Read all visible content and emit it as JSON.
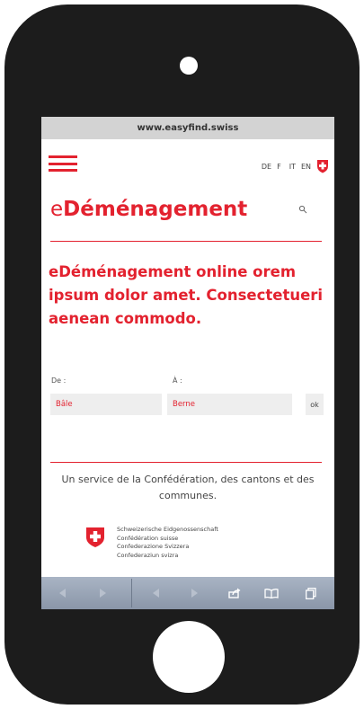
{
  "browser": {
    "url": "www.easyfind.swiss"
  },
  "header": {
    "languages": [
      "DE",
      "F",
      "IT",
      "EN"
    ],
    "menu_icon": "hamburger-icon",
    "flag_icon": "swiss-flag-icon"
  },
  "page": {
    "title_prefix": "e",
    "title_main": "Déménagement",
    "search_icon": "search-icon",
    "headline": "eDéménagement online orem ipsum dolor amet. Consectetueri aenean commodo."
  },
  "form": {
    "from_label": "De :",
    "to_label": "À :",
    "from_value": "Bâle",
    "to_value": "Berne",
    "ok_label": "ok"
  },
  "footer": {
    "service_text": "Un service de la Confédération, des cantons et des communes.",
    "confederation_names": [
      "Schweizerische Eidgenossenschaft",
      "Confédération suisse",
      "Confederazione Svizzera",
      "Confederaziun svizra"
    ]
  },
  "toolbar": {
    "icons": [
      "back-icon",
      "forward-icon",
      "back-icon",
      "forward-icon",
      "share-icon",
      "bookmarks-icon",
      "tabs-icon"
    ]
  },
  "colors": {
    "accent": "#e3222f",
    "phone_body": "#1c1c1c",
    "urlbar": "#d3d3d3",
    "toolbar": "#98a4b6"
  }
}
